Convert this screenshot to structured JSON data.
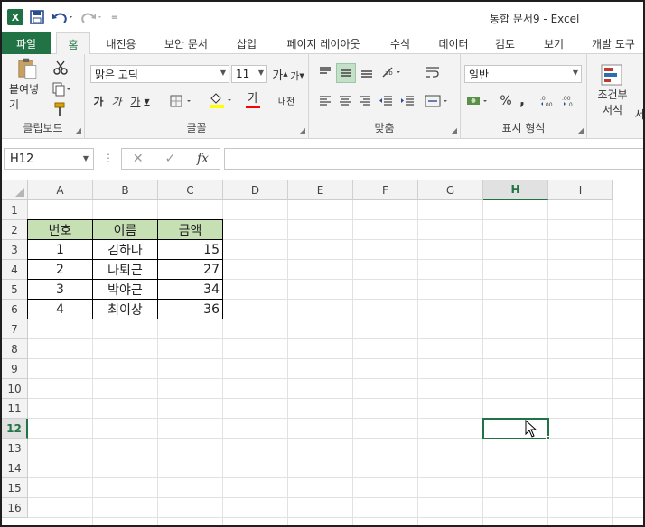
{
  "window": {
    "title": "통합 문서9  -  Excel",
    "logo": "X"
  },
  "qat": {
    "more": "="
  },
  "tabs": {
    "file": "파일",
    "items": [
      "홈",
      "삽입",
      "보안 문서",
      "삽입",
      "페이지 레이아웃",
      "수식",
      "데이터",
      "검토",
      "보기",
      "개발 도구"
    ],
    "home": "홈",
    "insert_menu": "내전용",
    "security": "보안 문서",
    "insert": "삽입",
    "layout": "페이지 레이아웃",
    "formula": "수식",
    "data": "데이터",
    "review": "검토",
    "view": "보기",
    "dev": "개발 도구"
  },
  "ribbon": {
    "clipboard": {
      "label": "클립보드",
      "paste": "붙여넣기"
    },
    "font": {
      "label": "글꼴",
      "name": "맑은 고딕",
      "size": "11",
      "bold": "가",
      "italic": "가",
      "underline": "가",
      "grow": "가",
      "shrink": "가",
      "color_char": "가",
      "phonetic": "내천"
    },
    "alignment": {
      "label": "맞춤"
    },
    "number": {
      "label": "표시 형식",
      "format": "일반",
      "percent": "%",
      "comma": ","
    },
    "styles": {
      "conditional_line1": "조건부",
      "conditional_line2": "서식",
      "more": "서"
    }
  },
  "formula_bar": {
    "name_box": "H12",
    "fx": "fx",
    "dots": "⋮",
    "value": ""
  },
  "columns": [
    "A",
    "B",
    "C",
    "D",
    "E",
    "F",
    "G",
    "H",
    "I"
  ],
  "rows": [
    "1",
    "2",
    "3",
    "4",
    "5",
    "6",
    "7",
    "8",
    "9",
    "10",
    "11",
    "12",
    "13",
    "14",
    "15",
    "16"
  ],
  "selected": {
    "column": "H",
    "row": "12"
  },
  "table": {
    "headers": [
      "번호",
      "이름",
      "금액"
    ],
    "rows": [
      [
        "1",
        "김하나",
        "15"
      ],
      [
        "2",
        "나퇴근",
        "27"
      ],
      [
        "3",
        "박야근",
        "34"
      ],
      [
        "4",
        "최이상",
        "36"
      ]
    ]
  },
  "colors": {
    "accent": "#217346",
    "header_fill": "#c6e0b4",
    "file_tab": "#217346"
  }
}
